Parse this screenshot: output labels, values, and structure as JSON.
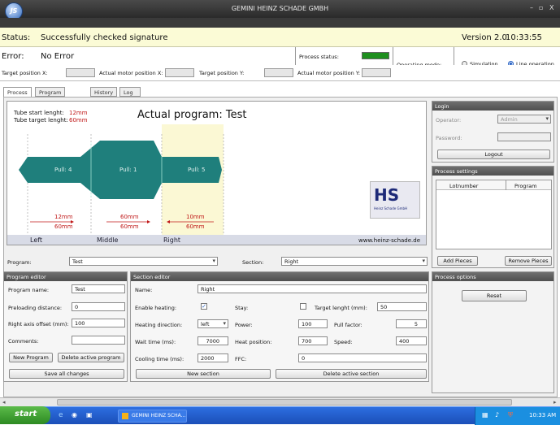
{
  "window": {
    "title": "GEMINI HEINZ SCHADE GMBH",
    "logo_text": "HS",
    "controls": [
      "–",
      "▫",
      "X"
    ]
  },
  "status": {
    "label": "Status:",
    "text": "Successfully checked signature",
    "version": "Version 2.0",
    "time": "10:33:55"
  },
  "error": {
    "label": "Error:",
    "text": "No Error",
    "process_status_label": "Process status:",
    "process_status_color": "#1e8f1e",
    "operating_mode_label": "Operating mode:",
    "mode_simulation": "Simulation",
    "mode_line": "Line operation"
  },
  "positions": {
    "target_x": "Target position X:",
    "actual_x": "Actual motor position X:",
    "target_y": "Target position Y:",
    "actual_y": "Actual motor position Y:"
  },
  "tabs": [
    "Process",
    "Program settings",
    "History",
    "Log book"
  ],
  "canvas": {
    "tube_start_label": "Tube start lenght:",
    "tube_start_value": "12mm",
    "tube_target_label": "Tube target lenght:",
    "tube_target_value": "60mm",
    "program_title": "Actual program: Test",
    "pulls": [
      "Pull: 4",
      "Pull: 1",
      "Pull: 5"
    ],
    "dims": [
      {
        "top": "12mm",
        "bottom": "60mm"
      },
      {
        "top": "60mm",
        "bottom": "60mm"
      },
      {
        "top": "10mm",
        "bottom": "60mm"
      }
    ],
    "sections": [
      "Left",
      "Middle",
      "Right"
    ],
    "website": "www.heinz-schade.de",
    "hs_logo": "HS",
    "hs_company": "Heinz Schade GmbH"
  },
  "login": {
    "title": "Login",
    "operator_label": "Operator:",
    "operator_value": "Admin",
    "password_label": "Password:",
    "logout": "Logout"
  },
  "process_settings": {
    "title": "Process settings",
    "col_lot": "Lotnumber",
    "col_program": "Program",
    "add": "Add Pieces",
    "remove": "Remove Pieces"
  },
  "process_options": {
    "title": "Process options",
    "reset": "Reset"
  },
  "program_select": {
    "label": "Program:",
    "value": "Test",
    "section_label": "Section:",
    "section_value": "Right"
  },
  "program_editor": {
    "title": "Program editor",
    "name_label": "Program name:",
    "name_value": "Test",
    "preload_label": "Preloading distance:",
    "preload_value": "0",
    "offset_label": "Right axis offset (mm):",
    "offset_value": "100",
    "comments_label": "Comments:",
    "new_program": "New Program",
    "delete_program": "Delete active program",
    "save_all": "Save all changes"
  },
  "section_editor": {
    "title": "Section editor",
    "name_label": "Name:",
    "name_value": "Right",
    "enable_heating_label": "Enable heating:",
    "stay_label": "Stay:",
    "target_len_label": "Target lenght (mm):",
    "target_len_value": "50",
    "heating_dir_label": "Heating direction:",
    "heating_dir_value": "left",
    "power_label": "Power:",
    "power_value": "100",
    "pull_factor_label": "Pull factor:",
    "pull_factor_value": "5",
    "wait_label": "Wait time (ms):",
    "wait_value": "7000",
    "heat_pos_label": "Heat position:",
    "heat_pos_value": "700",
    "speed_label": "Speed:",
    "speed_value": "400",
    "cooling_label": "Cooling time (ms):",
    "cooling_value": "2000",
    "ffc_label": "FFC:",
    "ffc_value": "0",
    "new_section": "New section",
    "delete_section": "Delete active section"
  },
  "taskbar": {
    "start": "start",
    "app": "GEMINI HEINZ SCHA...",
    "clock": "10:33 AM"
  }
}
